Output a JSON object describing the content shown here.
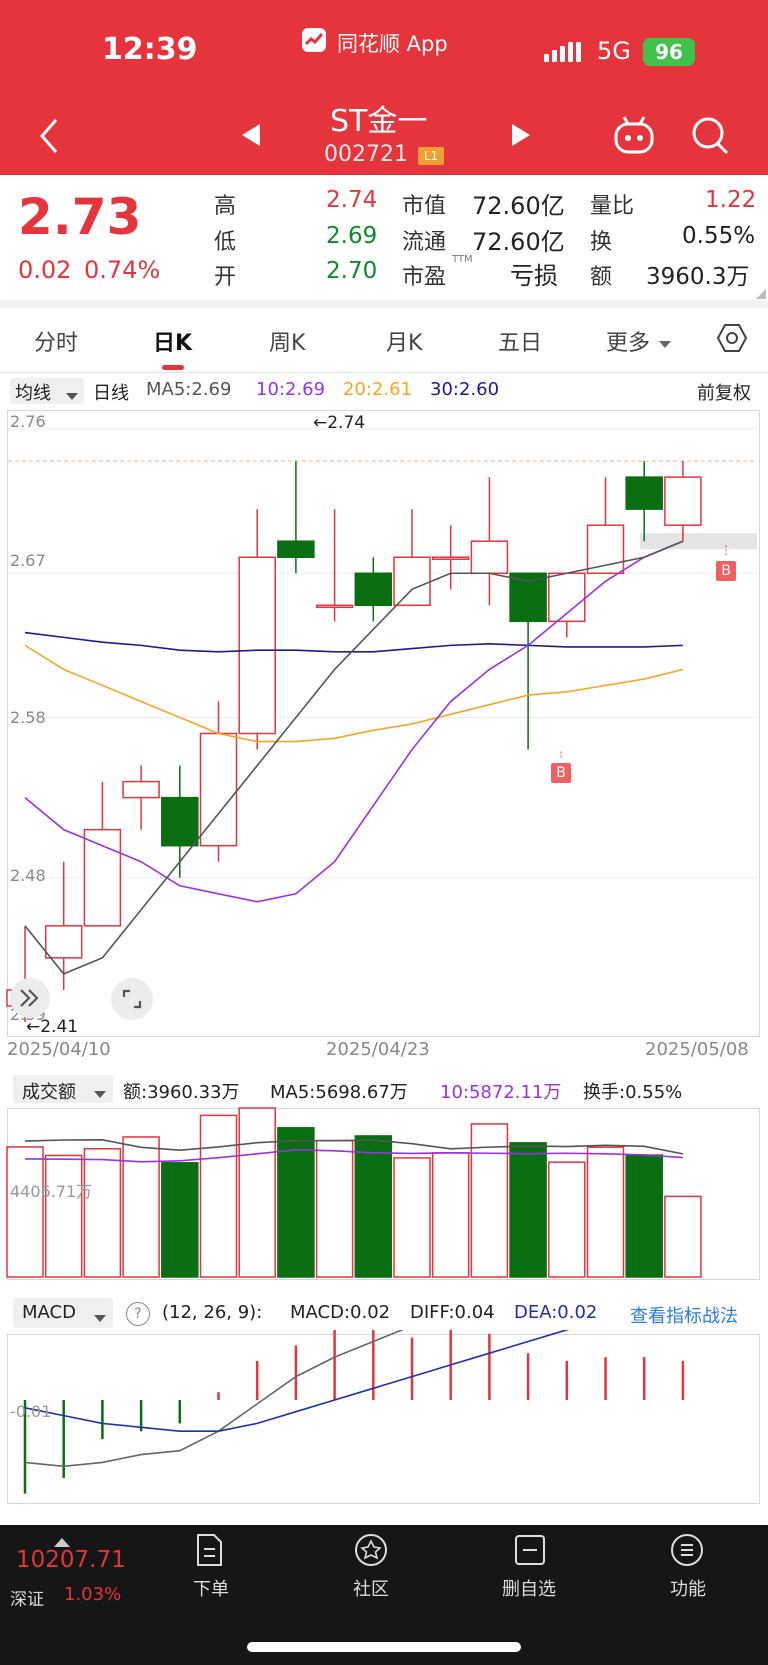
{
  "status_bar": {
    "time": "12:39",
    "app": "同花顺 App",
    "network": "5G",
    "battery": "96"
  },
  "header": {
    "title": "ST金一",
    "code": "002721",
    "level": "L1"
  },
  "quote": {
    "price": "2.73",
    "change": "0.02",
    "change_pct": "0.74%",
    "high_label": "高",
    "high": "2.74",
    "low_label": "低",
    "low": "2.69",
    "open_label": "开",
    "open": "2.70",
    "mktcap_label": "市值",
    "mktcap": "72.60亿",
    "float_label": "流通",
    "float": "72.60亿",
    "pe_label": "市盈",
    "pe_sup": "TTM",
    "pe": "亏损",
    "volratio_label": "量比",
    "volratio": "1.22",
    "turnover_label": "换",
    "turnover": "0.55%",
    "amount_label": "额",
    "amount": "3960.3万"
  },
  "tabs": [
    "分时",
    "日K",
    "周K",
    "月K",
    "五日",
    "更多"
  ],
  "active_tab": "日K",
  "kline_header": {
    "ma_select": "均线",
    "period": "日线",
    "ma5": "MA5:2.69",
    "ma10": "10:2.69",
    "ma20": "20:2.61",
    "ma30": "30:2.60",
    "adjust": "前复权"
  },
  "kline_axis": {
    "y_ticks": [
      "2.76",
      "2.67",
      "2.58",
      "2.48",
      "2.39"
    ],
    "dates": [
      "2025/04/10",
      "2025/04/23",
      "2025/05/08"
    ],
    "max_label": "←2.74",
    "min_label": "←2.41",
    "buy_mark": "B"
  },
  "volume_header": {
    "select": "成交额",
    "amount": "额:3960.33万",
    "ma5": "MA5:5698.67万",
    "ma10": "10:5872.11万",
    "turnover": "换手:0.55%",
    "axis_label": "4406.71万"
  },
  "macd_header": {
    "select": "MACD",
    "help": "?",
    "params": "(12, 26, 9):",
    "macd": "MACD:0.02",
    "diff": "DIFF:0.04",
    "dea": "DEA:0.02",
    "link": "查看指标战法",
    "axis_label": "-0.01"
  },
  "bottom": {
    "index_value": "10207.71",
    "index_name": "深证",
    "index_pct": "1.03%",
    "nav": [
      "下单",
      "社区",
      "删自选",
      "功能"
    ]
  },
  "colors": {
    "up": "#e5343c",
    "down": "#0a6e12",
    "ma5": "#555555",
    "ma10": "#9b30e8",
    "ma20": "#f5a623",
    "ma30": "#1a1a9a",
    "diff": "#666666",
    "dea": "#1f2fb0"
  },
  "chart_data": [
    {
      "type": "candlestick",
      "title": "日线",
      "dates": [
        "2025/04/10",
        "",
        "",
        "",
        "",
        "",
        "",
        "",
        "",
        "2025/04/23",
        "",
        "",
        "",
        "",
        "",
        "",
        "",
        "2025/05/08"
      ],
      "ohlc": [
        [
          2.4,
          2.45,
          2.39,
          2.41
        ],
        [
          2.43,
          2.49,
          2.41,
          2.45
        ],
        [
          2.45,
          2.54,
          2.45,
          2.51
        ],
        [
          2.53,
          2.55,
          2.51,
          2.54
        ],
        [
          2.53,
          2.55,
          2.48,
          2.5
        ],
        [
          2.5,
          2.59,
          2.49,
          2.57
        ],
        [
          2.57,
          2.71,
          2.56,
          2.68
        ],
        [
          2.69,
          2.74,
          2.67,
          2.68
        ],
        [
          2.65,
          2.71,
          2.64,
          2.65
        ],
        [
          2.67,
          2.68,
          2.64,
          2.65
        ],
        [
          2.65,
          2.71,
          2.65,
          2.68
        ],
        [
          2.68,
          2.7,
          2.66,
          2.68
        ],
        [
          2.67,
          2.73,
          2.65,
          2.69
        ],
        [
          2.67,
          2.67,
          2.56,
          2.64
        ],
        [
          2.64,
          2.67,
          2.63,
          2.67
        ],
        [
          2.67,
          2.73,
          2.67,
          2.7
        ],
        [
          2.73,
          2.74,
          2.69,
          2.71
        ],
        [
          2.7,
          2.74,
          2.69,
          2.73
        ]
      ],
      "ma5": [
        2.45,
        2.42,
        2.43,
        2.46,
        2.49,
        2.52,
        2.55,
        2.58,
        2.61,
        2.635,
        2.66,
        2.67,
        2.67,
        2.665,
        2.67,
        2.675,
        2.68,
        2.69
      ],
      "ma10": [
        2.53,
        2.51,
        2.5,
        2.49,
        2.475,
        2.47,
        2.465,
        2.47,
        2.49,
        2.525,
        2.56,
        2.59,
        2.61,
        2.625,
        2.645,
        2.665,
        2.68,
        2.69
      ],
      "ma20": [
        2.625,
        2.61,
        2.6,
        2.59,
        2.58,
        2.57,
        2.565,
        2.565,
        2.567,
        2.572,
        2.576,
        2.582,
        2.588,
        2.594,
        2.596,
        2.6,
        2.604,
        2.61
      ],
      "ma30": [
        2.633,
        2.63,
        2.627,
        2.625,
        2.622,
        2.621,
        2.622,
        2.622,
        2.621,
        2.621,
        2.623,
        2.625,
        2.626,
        2.625,
        2.624,
        2.624,
        2.624,
        2.625
      ],
      "ylim": [
        2.385,
        2.77
      ]
    },
    {
      "type": "bar",
      "title": "成交额",
      "unit": "万",
      "values": [
        6390,
        5970,
        6300,
        6880,
        5610,
        7940,
        8300,
        7330,
        6700,
        6930,
        5850,
        6100,
        7520,
        6590,
        5640,
        6380,
        5990,
        3960
      ],
      "ma5": [
        6680,
        6730,
        6740,
        6370,
        6230,
        6390,
        6600,
        6700,
        6700,
        6720,
        6550,
        6300,
        6380,
        6440,
        6410,
        6470,
        6420,
        6050
      ],
      "ma10": [
        5800,
        5790,
        5770,
        5660,
        5710,
        5860,
        6050,
        6250,
        6200,
        6100,
        6070,
        6100,
        6080,
        6060,
        6080,
        6050,
        6000,
        5870
      ]
    },
    {
      "type": "bar",
      "title": "MACD",
      "macd": [
        -0.024,
        -0.02,
        -0.01,
        -0.008,
        -0.006,
        0.002,
        0.01,
        0.014,
        0.018,
        0.018,
        0.016,
        0.018,
        0.017,
        0.012,
        0.01,
        0.011,
        0.011,
        0.01
      ],
      "diff": [
        -0.016,
        -0.017,
        -0.016,
        -0.014,
        -0.013,
        -0.008,
        -0.001,
        0.006,
        0.011,
        0.015,
        0.019,
        0.024,
        0.029,
        0.033,
        0.033,
        0.037,
        0.039,
        0.041
      ],
      "dea": [
        -0.002,
        -0.004,
        -0.006,
        -0.007,
        -0.008,
        -0.008,
        -0.006,
        -0.003,
        0.0,
        0.003,
        0.006,
        0.009,
        0.012,
        0.015,
        0.018,
        0.02,
        0.022,
        0.024
      ]
    }
  ]
}
